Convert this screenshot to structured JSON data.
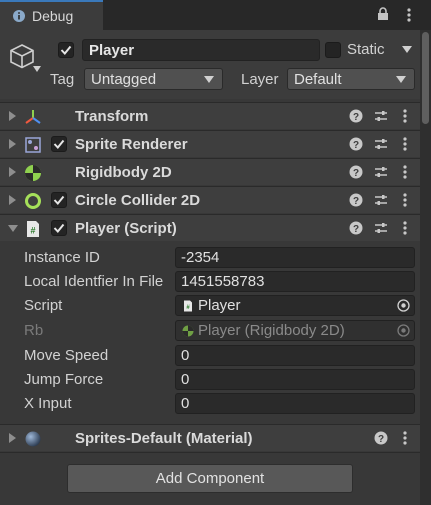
{
  "window": {
    "tab_title": "Debug"
  },
  "header": {
    "active": true,
    "object_name": "Player",
    "static_label": "Static",
    "static_checked": false,
    "tag_label": "Tag",
    "tag_value": "Untagged",
    "layer_label": "Layer",
    "layer_value": "Default"
  },
  "components": [
    {
      "title": "Transform",
      "icon": "transform-icon",
      "has_checkbox": false
    },
    {
      "title": "Sprite Renderer",
      "icon": "sprite-renderer-icon",
      "has_checkbox": true,
      "checked": true
    },
    {
      "title": "Rigidbody 2D",
      "icon": "rigidbody2d-icon",
      "has_checkbox": false
    },
    {
      "title": "Circle Collider 2D",
      "icon": "circle-collider-icon",
      "has_checkbox": true,
      "checked": true
    },
    {
      "title": "Player (Script)",
      "icon": "script-icon",
      "has_checkbox": true,
      "checked": true,
      "expanded": true
    },
    {
      "title": "Sprites-Default (Material)",
      "icon": "material-icon",
      "has_checkbox": false
    }
  ],
  "script_properties": [
    {
      "label": "Instance ID",
      "value": "-2354"
    },
    {
      "label": "Local Identfier In File",
      "value": "1451558783"
    },
    {
      "label": "Script",
      "value": "Player",
      "type": "object"
    },
    {
      "label": "Rb",
      "value": "Player (Rigidbody 2D)",
      "type": "object",
      "disabled": true
    },
    {
      "label": "Move Speed",
      "value": "0"
    },
    {
      "label": "Jump Force",
      "value": "0"
    },
    {
      "label": "X Input",
      "value": "0"
    }
  ],
  "footer": {
    "add_component_label": "Add Component"
  },
  "colors": {
    "accent_blue": "#3a79bb",
    "rigidbody_green": "#8fd14f",
    "collider_green": "#a6e05a"
  }
}
